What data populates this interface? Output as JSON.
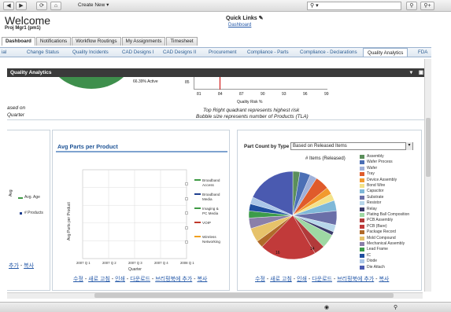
{
  "toolbar": {
    "create_new": "Create New",
    "search_value": "",
    "back_icon": "◀",
    "forward_icon": "▶",
    "refresh_icon": "⟳",
    "home_icon": "⌂",
    "search_icon": "⚲",
    "search_go": "⚲+"
  },
  "header": {
    "title": "Welcome",
    "subtitle": "Proj Mgr1 (pm1)",
    "quick_links": "Quick Links",
    "quick_link_item": "Dashboard"
  },
  "main_tabs": [
    "Dashboard",
    "Notifications",
    "Workflow Routings",
    "My Assignments",
    "Timesheet"
  ],
  "sub_tabs": [
    "ial",
    "Change Status",
    "Quality Incidents",
    "CAD Designs I",
    "CAD Designs II",
    "Procurement",
    "Compliance - Parts",
    "Compliance - Declarations",
    "Quality Analytics",
    "FDA"
  ],
  "qa_panel": {
    "title": "Quality Analytics",
    "bubble_active": "66.39% Active",
    "bubble_axis_title": "Quality Risk %",
    "bubble_ticks": [
      "81",
      "84",
      "87",
      "90",
      "93",
      "96",
      "99"
    ],
    "bubble_y": "85",
    "note1": "Top Right quadrant represents highest risk",
    "note2": "Bubble size represents number of Products (TLA)",
    "left_text1": "ased on",
    "left_text2": "Quarter"
  },
  "left_panel": {
    "legend": [
      "Avg. Age",
      "# Products"
    ],
    "axis_label": "Avg",
    "links": [
      "추가",
      "복사"
    ]
  },
  "mid_panel": {
    "title": "Avg Parts per Product",
    "links": [
      "수정",
      "새로 고침",
      "인쇄",
      "다운로드",
      "브리핑북에 추가",
      "복사"
    ]
  },
  "right_panel": {
    "title": "Part Count by Type",
    "dropdown": "Based on Released Items",
    "pie_title": "# Items (Released)",
    "links": [
      "수정",
      "새로 고침",
      "인쇄",
      "다운로드",
      "브리핑북에 추가",
      "복사"
    ]
  },
  "chart_data": [
    {
      "type": "line",
      "title": "Avg Parts per Product",
      "categories": [
        "2007 Q 1",
        "2007 Q 2",
        "2007 Q 3",
        "2007 Q 4",
        "2008 Q 1"
      ],
      "ylabel": "Avg Parts per Product",
      "xlabel": "Quarter",
      "series": [
        {
          "name": "Broadband Access",
          "values": [
            null,
            null,
            null,
            null,
            null
          ]
        },
        {
          "name": "Broadband Media",
          "values": [
            null,
            null,
            null,
            null,
            null
          ]
        },
        {
          "name": "Imaging & PC Media",
          "values": [
            null,
            null,
            null,
            null,
            null
          ]
        },
        {
          "name": "VOIP",
          "values": [
            null,
            null,
            null,
            null,
            null
          ]
        },
        {
          "name": "Wireless Networking",
          "values": [
            null,
            null,
            null,
            null,
            null
          ]
        }
      ],
      "legend_colors": [
        "#3f9b45",
        "#1f3f8f",
        "#3f9b45",
        "#c0392b",
        "#f0a020"
      ],
      "grid": true,
      "legend_position": "right"
    },
    {
      "type": "pie",
      "title": "# Items (Released)",
      "slice_labels": [
        "16",
        "14"
      ],
      "categories": [
        "Assembly",
        "Wafer Process",
        "Wafer",
        "Tray",
        "Device Assembly",
        "Bond Wire",
        "Capacitor",
        "Substrate",
        "Resistor",
        "Relay",
        "Plating Ball Composition",
        "PCB Assembly",
        "PCB (Bare)",
        "Package Record",
        "Mold Compound",
        "Mechanical Assembly",
        "Lead Frame",
        "IC",
        "Diode",
        "Die Attach"
      ],
      "values": [
        2,
        3,
        2,
        4,
        2,
        2,
        3,
        4,
        2,
        1,
        4,
        3,
        16,
        2,
        4,
        3,
        2,
        2,
        2,
        14
      ],
      "colors": [
        "#5b8f5b",
        "#4b6fb5",
        "#9fb0d9",
        "#e05b2b",
        "#f29a2e",
        "#f3e28a",
        "#7fb8d8",
        "#6a6fa8",
        "#b7d6ea",
        "#3a3a6a",
        "#9ed8a3",
        "#b23a3a",
        "#c13a3a",
        "#b06a2a",
        "#e6c26a",
        "#8a7fa9",
        "#3c9c4a",
        "#1f4f9f",
        "#aac6e8",
        "#4a5ab0"
      ],
      "legend_position": "right"
    }
  ]
}
